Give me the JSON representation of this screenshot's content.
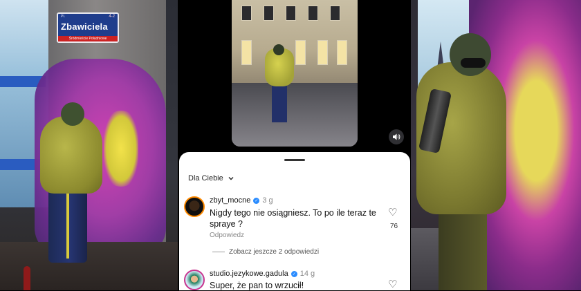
{
  "left_photo": {
    "street_sign": {
      "prefix": "PI.",
      "number": "4-2",
      "name": "Zbawiciela",
      "subtitle": "Śródmieście Południowe"
    }
  },
  "video": {
    "sound_icon": "speaker-icon"
  },
  "comments_sheet": {
    "filter_label": "Dla Ciebie",
    "filter_icon": "chevron-down-icon",
    "comments": [
      {
        "username": "zbyt_mocne",
        "verified": true,
        "time": "3 g",
        "text": "Nigdy tego nie osiągniesz. To po ile teraz te spraye ?",
        "reply_label": "Odpowiedz",
        "likes": "76",
        "more_replies": "Zobacz jeszcze 2 odpowiedzi"
      },
      {
        "username": "studio.jezykowe.gadula",
        "verified": true,
        "time": "14 g",
        "text": "Super, że pan to wrzucił!"
      }
    ]
  }
}
